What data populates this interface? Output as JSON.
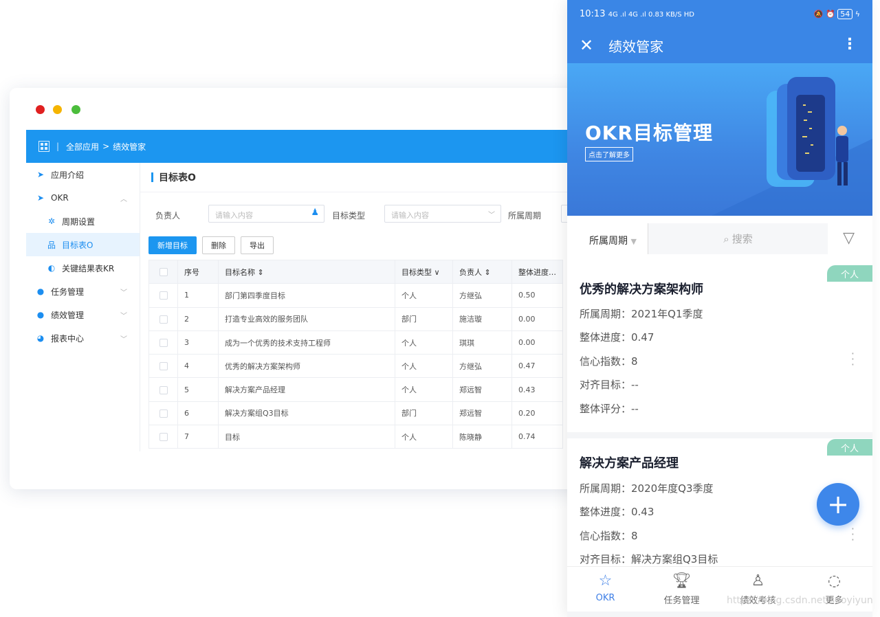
{
  "desktop": {
    "window_dots": [
      "#e02020",
      "#f5b400",
      "#4bbd3c"
    ],
    "breadcrumb": {
      "sep": "|",
      "all_apps": "全部应用",
      "arrow": ">",
      "current": "绩效管家"
    },
    "sidebar": [
      {
        "label": "应用介绍",
        "icon": "send-icon"
      },
      {
        "label": "OKR",
        "icon": "send-icon"
      },
      {
        "label": "周期设置",
        "icon": "cycle-icon"
      },
      {
        "label": "目标表O",
        "icon": "org-chart-icon"
      },
      {
        "label": "关键结果表KR",
        "icon": "planet-icon"
      },
      {
        "label": "任务管理",
        "icon": "user-icon"
      },
      {
        "label": "绩效管理",
        "icon": "user-icon"
      },
      {
        "label": "报表中心",
        "icon": "pie-icon"
      }
    ],
    "page_title": "目标表O",
    "filters": {
      "owner_label": "负责人",
      "owner_placeholder": "请输入内容",
      "type_label": "目标类型",
      "type_placeholder": "请输入内容",
      "period_label": "所属周期"
    },
    "buttons": {
      "add": "新增目标",
      "delete": "删除",
      "export": "导出"
    },
    "table": {
      "headers": [
        "序号",
        "目标名称 ⇕",
        "目标类型 ∨",
        "负责人 ⇕",
        "整体进度…"
      ],
      "rows": [
        [
          "1",
          "部门第四季度目标",
          "个人",
          "方继弘",
          "0.50"
        ],
        [
          "2",
          "打造专业高效的服务团队",
          "部门",
          "施洁璇",
          "0.00"
        ],
        [
          "3",
          "成为一个优秀的技术支持工程师",
          "个人",
          "琪琪",
          "0.00"
        ],
        [
          "4",
          "优秀的解决方案架构师",
          "个人",
          "方继弘",
          "0.47"
        ],
        [
          "5",
          "解决方案产品经理",
          "个人",
          "郑远智",
          "0.43"
        ],
        [
          "6",
          "解决方案组Q3目标",
          "部门",
          "郑远智",
          "0.20"
        ],
        [
          "7",
          "目标",
          "个人",
          "陈晓静",
          "0.74"
        ]
      ]
    }
  },
  "mobile": {
    "status": {
      "time": "10:13",
      "signal": "4G .ıl 4G .ıl 0.83 KB/S HD",
      "right": "54"
    },
    "appbar": {
      "close": "✕",
      "title": "绩效管家",
      "more": "⋮"
    },
    "banner": {
      "title": "OKR目标管理",
      "cta": "点击了解更多"
    },
    "search": {
      "period": "所属周期",
      "placeholder": "搜索"
    },
    "cards": [
      {
        "badge": "个人",
        "title": "优秀的解决方案架构师",
        "lines": [
          "所属周期：2021年Q1季度",
          "整体进度：0.47",
          "信心指数：8",
          "对齐目标：--",
          "整体评分：--"
        ]
      },
      {
        "badge": "个人",
        "title": "解决方案产品经理",
        "lines": [
          "所属周期：2020年度Q3季度",
          "整体进度：0.43",
          "信心指数：8",
          "对齐目标：解决方案组Q3目标"
        ]
      }
    ],
    "fab": "+",
    "tabs": [
      {
        "label": "OKR",
        "icon": "star-icon"
      },
      {
        "label": "任务管理",
        "icon": "trophy-icon"
      },
      {
        "label": "绩效考核",
        "icon": "person-clock-icon"
      },
      {
        "label": "更多",
        "icon": "planet-icon"
      }
    ],
    "watermark": "https://blog.csdn.net/sdoyiyun"
  }
}
